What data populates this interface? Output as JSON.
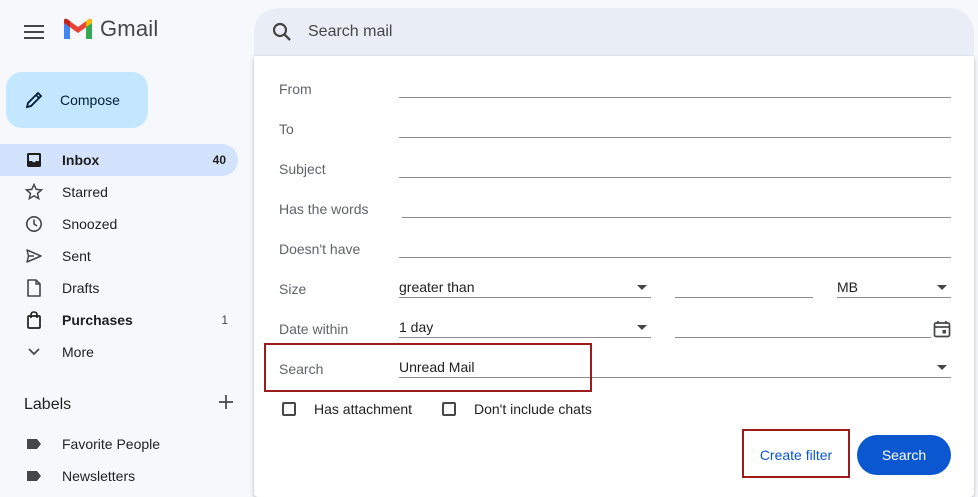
{
  "header": {
    "app_name": "Gmail",
    "search_placeholder": "Search mail"
  },
  "sidebar": {
    "compose_label": "Compose",
    "items": [
      {
        "label": "Inbox",
        "count": "40",
        "icon": "inbox-icon",
        "active": true
      },
      {
        "label": "Starred",
        "count": "",
        "icon": "star-icon"
      },
      {
        "label": "Snoozed",
        "count": "",
        "icon": "clock-icon"
      },
      {
        "label": "Sent",
        "count": "",
        "icon": "send-icon"
      },
      {
        "label": "Drafts",
        "count": "",
        "icon": "draft-icon"
      },
      {
        "label": "Purchases",
        "count": "1",
        "icon": "shopping-bag-icon",
        "bold": true
      },
      {
        "label": "More",
        "count": "",
        "icon": "chevron-down-icon"
      }
    ],
    "labels_title": "Labels",
    "labels": [
      {
        "label": "Favorite People",
        "icon": "label-icon"
      },
      {
        "label": "Newsletters",
        "icon": "label-icon"
      }
    ]
  },
  "advanced_search": {
    "from_label": "From",
    "to_label": "To",
    "subject_label": "Subject",
    "has_words_label": "Has the words",
    "doesnt_have_label": "Doesn't have",
    "size_label": "Size",
    "size_operator": "greater than",
    "size_value": "",
    "size_unit": "MB",
    "date_within_label": "Date within",
    "date_within_value": "1 day",
    "date_value": "",
    "search_label": "Search",
    "search_scope": "Unread Mail",
    "has_attachment_label": "Has attachment",
    "dont_include_chats_label": "Don't include chats",
    "create_filter_label": "Create filter",
    "search_button_label": "Search"
  },
  "colors": {
    "accent": "#0b57d0",
    "compose_bg": "#c2e7ff",
    "active_nav_bg": "#d3e3fd",
    "highlight_box": "#9c1c1c"
  }
}
